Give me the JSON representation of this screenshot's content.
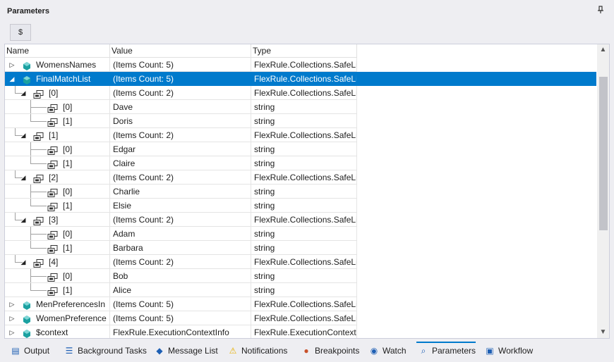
{
  "panel": {
    "title": "Parameters",
    "pin_glyph": "▾"
  },
  "toolbar": {
    "button_label": "$"
  },
  "grid": {
    "columns": [
      "Name",
      "Value",
      "Type"
    ],
    "rows": [
      {
        "name": "WomensNames",
        "value": "(Items Count: 5)",
        "type": "FlexRule.Collections.SafeLi",
        "level": 0,
        "expander": "collapsed",
        "icon": "field"
      },
      {
        "name": "FinalMatchList",
        "value": "(Items Count: 5)",
        "type": "FlexRule.Collections.SafeLi",
        "level": 0,
        "expander": "expanded",
        "icon": "field",
        "selected": true
      },
      {
        "name": "[0]",
        "value": "(Items Count: 2)",
        "type": "FlexRule.Collections.SafeLi",
        "level": 1,
        "expander": "expanded",
        "icon": "item"
      },
      {
        "name": "[0]",
        "value": "Dave",
        "type": "string",
        "level": 2,
        "expander": "none",
        "icon": "item"
      },
      {
        "name": "[1]",
        "value": "Doris",
        "type": "string",
        "level": 2,
        "expander": "none",
        "icon": "item",
        "last": true
      },
      {
        "name": "[1]",
        "value": "(Items Count: 2)",
        "type": "FlexRule.Collections.SafeLi",
        "level": 1,
        "expander": "expanded",
        "icon": "item"
      },
      {
        "name": "[0]",
        "value": "Edgar",
        "type": "string",
        "level": 2,
        "expander": "none",
        "icon": "item"
      },
      {
        "name": "[1]",
        "value": "Claire",
        "type": "string",
        "level": 2,
        "expander": "none",
        "icon": "item",
        "last": true
      },
      {
        "name": "[2]",
        "value": "(Items Count: 2)",
        "type": "FlexRule.Collections.SafeLi",
        "level": 1,
        "expander": "expanded",
        "icon": "item"
      },
      {
        "name": "[0]",
        "value": "Charlie",
        "type": "string",
        "level": 2,
        "expander": "none",
        "icon": "item"
      },
      {
        "name": "[1]",
        "value": "Elsie",
        "type": "string",
        "level": 2,
        "expander": "none",
        "icon": "item",
        "last": true
      },
      {
        "name": "[3]",
        "value": "(Items Count: 2)",
        "type": "FlexRule.Collections.SafeLi",
        "level": 1,
        "expander": "expanded",
        "icon": "item"
      },
      {
        "name": "[0]",
        "value": "Adam",
        "type": "string",
        "level": 2,
        "expander": "none",
        "icon": "item"
      },
      {
        "name": "[1]",
        "value": "Barbara",
        "type": "string",
        "level": 2,
        "expander": "none",
        "icon": "item",
        "last": true
      },
      {
        "name": "[4]",
        "value": "(Items Count: 2)",
        "type": "FlexRule.Collections.SafeLi",
        "level": 1,
        "expander": "expanded",
        "icon": "item"
      },
      {
        "name": "[0]",
        "value": "Bob",
        "type": "string",
        "level": 2,
        "expander": "none",
        "icon": "item"
      },
      {
        "name": "[1]",
        "value": "Alice",
        "type": "string",
        "level": 2,
        "expander": "none",
        "icon": "item",
        "last": true
      },
      {
        "name": "MenPreferencesIn",
        "value": "(Items Count: 5)",
        "type": "FlexRule.Collections.SafeLi",
        "level": 0,
        "expander": "collapsed",
        "icon": "field"
      },
      {
        "name": "WomenPreference",
        "value": "(Items Count: 5)",
        "type": "FlexRule.Collections.SafeLi",
        "level": 0,
        "expander": "collapsed",
        "icon": "field"
      },
      {
        "name": "$context",
        "value": "FlexRule.ExecutionContextInfo",
        "type": "FlexRule.ExecutionContextI",
        "level": 0,
        "expander": "collapsed",
        "icon": "field"
      }
    ]
  },
  "tabs": [
    {
      "label": "Output",
      "icon": "output-icon",
      "glyph": "▤"
    },
    {
      "label": "Background Tasks",
      "icon": "tasks-icon",
      "glyph": "☰"
    },
    {
      "label": "Message List",
      "icon": "message-icon",
      "glyph": "◆"
    },
    {
      "label": "Notifications",
      "icon": "warning-icon",
      "glyph": "⚠"
    },
    {
      "label": "Breakpoints",
      "icon": "breakpoint-icon",
      "glyph": "●"
    },
    {
      "label": "Watch",
      "icon": "eye-icon",
      "glyph": "◉"
    },
    {
      "label": "Parameters",
      "icon": "search-icon",
      "glyph": "⌕",
      "active": true
    },
    {
      "label": "Workflow",
      "icon": "workflow-icon",
      "glyph": "▣"
    }
  ],
  "colors": {
    "accent": "#007acc",
    "field_icon": "#1ba1a1",
    "warning": "#e8b000",
    "breakpoint": "#c8512a"
  }
}
